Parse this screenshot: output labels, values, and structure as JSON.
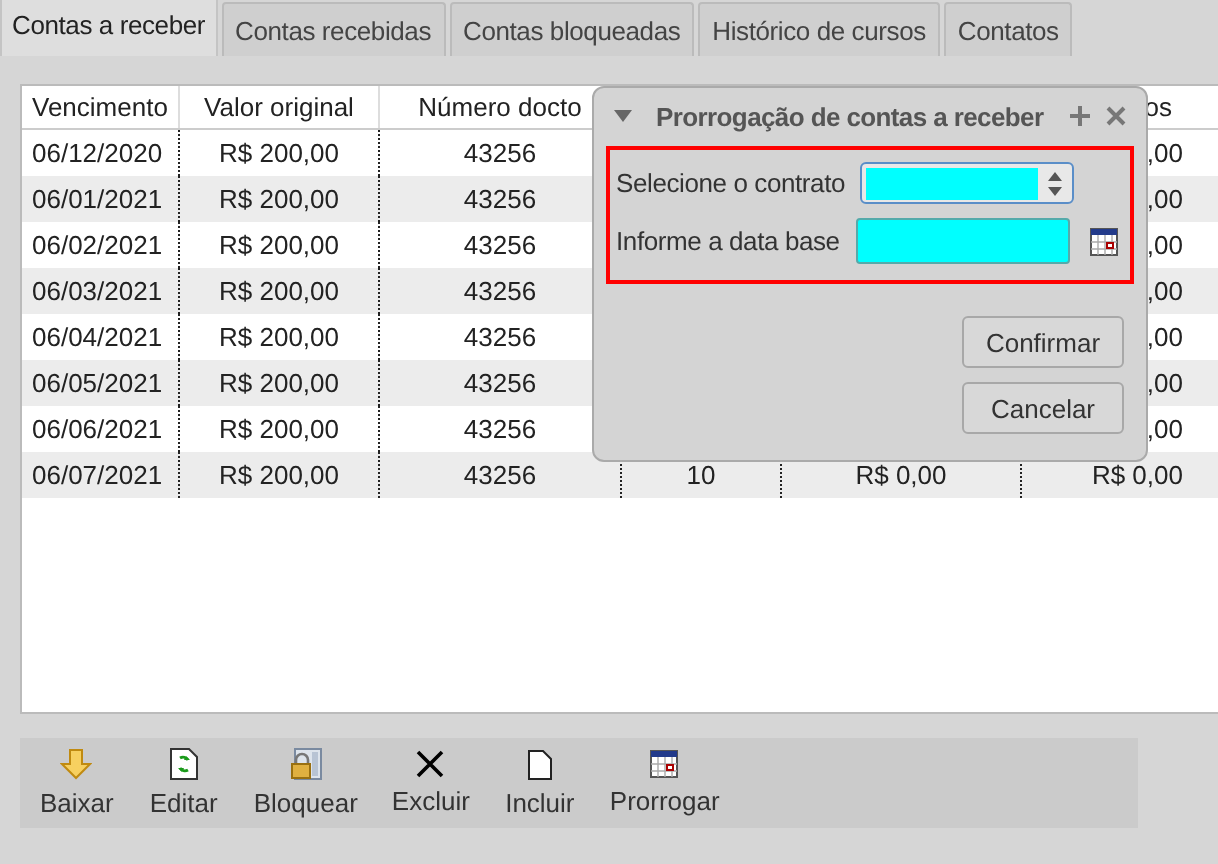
{
  "tabs": [
    {
      "label": "Contas a receber",
      "selected": true
    },
    {
      "label": "Contas recebidas",
      "selected": false
    },
    {
      "label": "Contas bloqueadas",
      "selected": false
    },
    {
      "label": "Histórico de cursos",
      "selected": false
    },
    {
      "label": "Contatos",
      "selected": false
    }
  ],
  "table": {
    "columns": [
      "Vencimento",
      "Valor original",
      "Número docto",
      null,
      null,
      "os"
    ],
    "rows": [
      {
        "cells": [
          "06/12/2020",
          "R$ 200,00",
          "43256",
          null,
          null,
          ",00"
        ]
      },
      {
        "cells": [
          "06/01/2021",
          "R$ 200,00",
          "43256",
          null,
          null,
          ",00"
        ]
      },
      {
        "cells": [
          "06/02/2021",
          "R$ 200,00",
          "43256",
          null,
          null,
          ",00"
        ]
      },
      {
        "cells": [
          "06/03/2021",
          "R$ 200,00",
          "43256",
          null,
          null,
          ",00"
        ]
      },
      {
        "cells": [
          "06/04/2021",
          "R$ 200,00",
          "43256",
          null,
          null,
          ",00"
        ]
      },
      {
        "cells": [
          "06/05/2021",
          "R$ 200,00",
          "43256",
          null,
          null,
          ",00"
        ]
      },
      {
        "cells": [
          "06/06/2021",
          "R$ 200,00",
          "43256",
          null,
          null,
          ",00"
        ]
      },
      {
        "cells": [
          "06/07/2021",
          "R$ 200,00",
          "43256",
          "10",
          "R$ 0,00",
          "R$ 0,00"
        ]
      }
    ]
  },
  "dialog": {
    "title": "Prorrogação de contas a receber",
    "fields": [
      {
        "kind": "spinbox",
        "label": "Selecione o contrato"
      },
      {
        "kind": "date",
        "label": "Informe a data base"
      }
    ],
    "buttons": [
      "Confirmar",
      "Cancelar"
    ]
  },
  "toolbar": [
    "Baixar",
    "Editar",
    "Bloquear",
    "Excluir",
    "Incluir",
    "Prorrogar"
  ]
}
